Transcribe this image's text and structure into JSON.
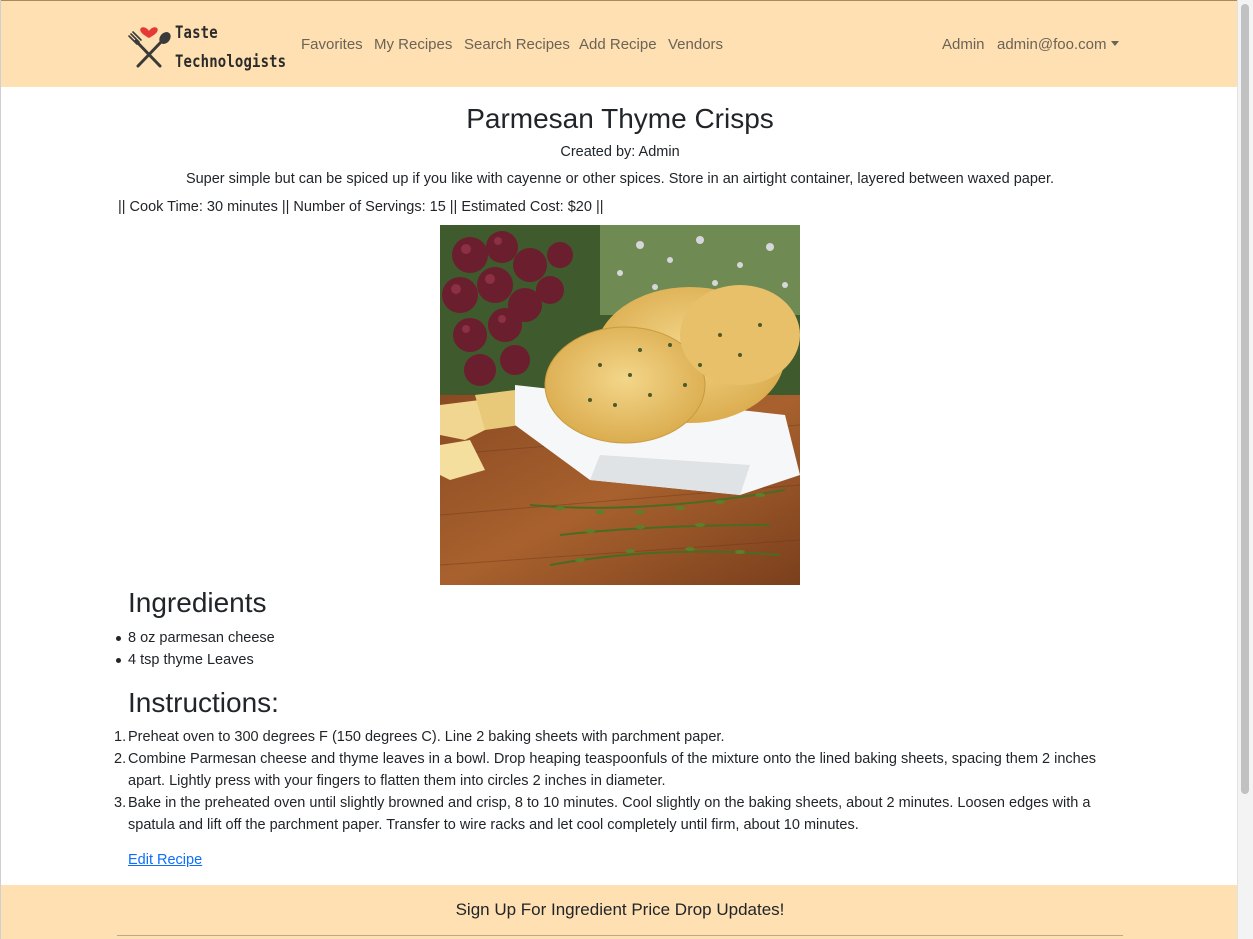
{
  "brand": {
    "line1": "Taste",
    "line2": "Technologists"
  },
  "nav": {
    "items": [
      {
        "label": "Favorites"
      },
      {
        "label": "My Recipes"
      },
      {
        "label": "Search Recipes"
      },
      {
        "label": "Add Recipe"
      },
      {
        "label": "Vendors"
      }
    ],
    "admin_label": "Admin",
    "user_email": "admin@foo.com"
  },
  "recipe": {
    "title": "Parmesan Thyme Crisps",
    "created_by": "Created by: Admin",
    "description": "Super simple but can be spiced up if you like with cayenne or other spices. Store in an airtight container, layered between waxed paper.",
    "meta": "|| Cook Time: 30 minutes || Number of Servings: 15 || Estimated Cost: $20 ||",
    "ingredients_heading": "Ingredients",
    "ingredients": [
      "8 oz parmesan cheese",
      "4 tsp thyme Leaves"
    ],
    "instructions_heading": "Instructions:",
    "instructions": [
      {
        "num": "1.",
        "text": "Preheat oven to 300 degrees F (150 degrees C). Line 2 baking sheets with parchment paper."
      },
      {
        "num": "2.",
        "text": "Combine Parmesan cheese and thyme leaves in a bowl. Drop heaping teaspoonfuls of the mixture onto the lined baking sheets, spacing them 2 inches apart. Lightly press with your fingers to flatten them into circles 2 inches in diameter."
      },
      {
        "num": "3.",
        "text": "Bake in the preheated oven until slightly browned and crisp, 8 to 10 minutes. Cool slightly on the baking sheets, about 2 minutes. Loosen edges with a spatula and lift off the parchment paper. Transfer to wire racks and let cool completely until firm, about 10 minutes."
      }
    ],
    "edit_label": "Edit Recipe"
  },
  "footer": {
    "signup_text": "Sign Up For Ingredient Price Drop Updates!"
  },
  "colors": {
    "navbar_bg": "#ffe0b2",
    "link": "#0d6efd",
    "heart": "#e53935"
  }
}
